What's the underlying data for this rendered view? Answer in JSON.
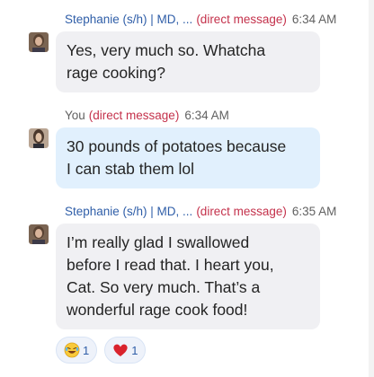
{
  "messages": [
    {
      "sender": "Stephanie (s/h) | MD, ...",
      "tag": "(direct message)",
      "time": "6:34 AM",
      "text_lines": [
        "Yes, very much so. Whatcha",
        "rage cooking?"
      ]
    },
    {
      "sender": "You",
      "tag": "(direct message)",
      "time": "6:34 AM",
      "text_lines": [
        "30 pounds of potatoes because",
        "I can stab them lol"
      ]
    },
    {
      "sender": "Stephanie (s/h) | MD, ...",
      "tag": "(direct message)",
      "time": "6:35 AM",
      "text_lines": [
        "I’m really glad I swallowed",
        "before I read that. I heart you,",
        "Cat. So very much. That’s a",
        "wonderful rage cook food!"
      ]
    }
  ],
  "reactions": [
    {
      "icon": "laughing-emoji-icon",
      "count": "1"
    },
    {
      "icon": "heart-icon",
      "count": "1"
    }
  ],
  "colors": {
    "sender": "#2f5ea8",
    "tag": "#c4314b",
    "incoming_bubble": "#f0f0f3",
    "outgoing_bubble": "#e1f0fd"
  }
}
